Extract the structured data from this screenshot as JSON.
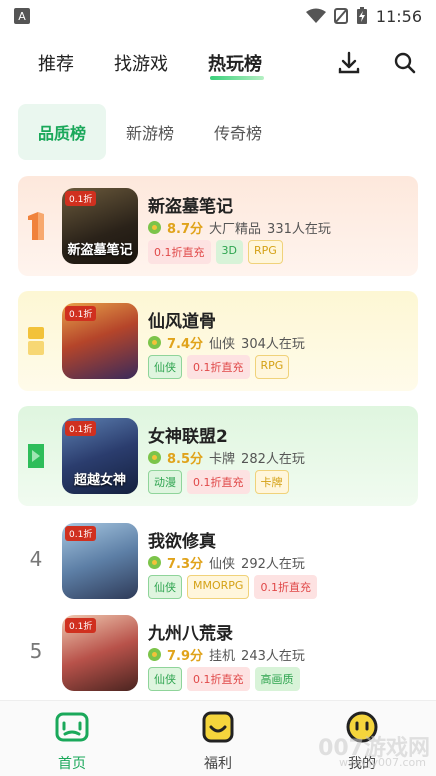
{
  "status_bar": {
    "left_icon": "A",
    "time": "11:56",
    "icons": [
      "wifi-icon",
      "no-sim-icon",
      "battery-charging-icon"
    ]
  },
  "top_nav": {
    "tabs": [
      {
        "label": "推荐"
      },
      {
        "label": "找游戏"
      },
      {
        "label": "热玩榜",
        "active": true
      }
    ],
    "icons": [
      "download-icon",
      "search-icon"
    ]
  },
  "sub_tabs": [
    {
      "label": "品质榜",
      "active": true
    },
    {
      "label": "新游榜"
    },
    {
      "label": "传奇榜"
    }
  ],
  "games": [
    {
      "rank": "1",
      "name": "新盗墓笔记",
      "score": "8.7分",
      "category": "大厂精品",
      "players": "331人在玩",
      "thumb_badge": "0.1折",
      "thumb_title": "新盗墓笔记",
      "tags": [
        {
          "text": "0.1折直充",
          "style": "red"
        },
        {
          "text": "3D",
          "style": "green-fill"
        },
        {
          "text": "RPG",
          "style": "yellow"
        }
      ]
    },
    {
      "rank": "2",
      "name": "仙风道骨",
      "score": "7.4分",
      "category": "仙侠",
      "players": "304人在玩",
      "thumb_badge": "0.1折",
      "thumb_title": "",
      "tags": [
        {
          "text": "仙侠",
          "style": "green"
        },
        {
          "text": "0.1折直充",
          "style": "red"
        },
        {
          "text": "RPG",
          "style": "yellow"
        }
      ]
    },
    {
      "rank": "3",
      "name": "女神联盟2",
      "score": "8.5分",
      "category": "卡牌",
      "players": "282人在玩",
      "thumb_badge": "0.1折",
      "thumb_title": "超越女神",
      "tags": [
        {
          "text": "动漫",
          "style": "green"
        },
        {
          "text": "0.1折直充",
          "style": "red"
        },
        {
          "text": "卡牌",
          "style": "yellow"
        }
      ]
    },
    {
      "rank": "4",
      "name": "我欲修真",
      "score": "7.3分",
      "category": "仙侠",
      "players": "292人在玩",
      "thumb_badge": "0.1折",
      "thumb_title": "",
      "tags": [
        {
          "text": "仙侠",
          "style": "green"
        },
        {
          "text": "MMORPG",
          "style": "yellow"
        },
        {
          "text": "0.1折直充",
          "style": "red"
        }
      ]
    },
    {
      "rank": "5",
      "name": "九州八荒录",
      "score": "7.9分",
      "category": "挂机",
      "players": "243人在玩",
      "thumb_badge": "0.1折",
      "thumb_title": "",
      "tags": [
        {
          "text": "仙侠",
          "style": "green"
        },
        {
          "text": "0.1折直充",
          "style": "red"
        },
        {
          "text": "高画质",
          "style": "green-fill"
        }
      ]
    }
  ],
  "bottom_nav": [
    {
      "label": "首页",
      "icon": "gamepad-icon",
      "active": true
    },
    {
      "label": "福利",
      "icon": "gift-icon"
    },
    {
      "label": "我的",
      "icon": "face-icon"
    }
  ],
  "watermark": {
    "text": "007游戏网",
    "sub": "www.jy007.com"
  },
  "colors": {
    "accent": "#1aa85a",
    "rank1": "#f0823c",
    "rank2": "#f2c23a",
    "rank3": "#2ebd5a"
  }
}
